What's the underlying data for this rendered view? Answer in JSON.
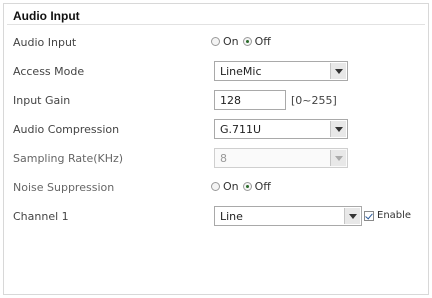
{
  "section": {
    "title": "Audio Input"
  },
  "rows": {
    "audio_input": {
      "label": "Audio Input",
      "on_label": "On",
      "off_label": "Off",
      "selected": "Off"
    },
    "access_mode": {
      "label": "Access Mode",
      "value": "LineMic"
    },
    "input_gain": {
      "label": "Input Gain",
      "value": "128",
      "range": "[0~255]"
    },
    "audio_compression": {
      "label": "Audio Compression",
      "value": "G.711U"
    },
    "sampling_rate": {
      "label": "Sampling Rate(KHz)",
      "value": "8"
    },
    "noise_suppression": {
      "label": "Noise Suppression",
      "on_label": "On",
      "off_label": "Off",
      "selected": "Off"
    },
    "channel_1": {
      "label": "Channel 1",
      "value": "Line",
      "enable_label": "Enable",
      "enabled": true
    }
  }
}
